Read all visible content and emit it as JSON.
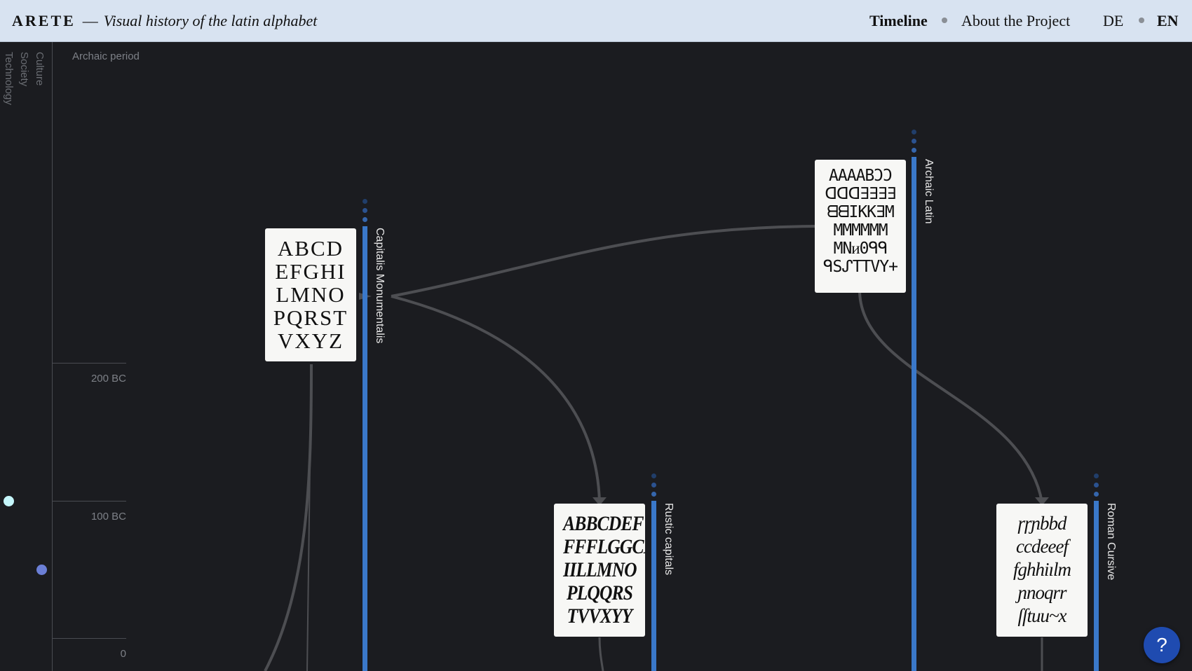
{
  "header": {
    "brand": "ARETE",
    "dash": "—",
    "tagline": "Visual history of the latin alphabet",
    "nav_timeline": "Timeline",
    "nav_about": "About the Project",
    "lang_de": "DE",
    "lang_en": "EN"
  },
  "sidebar": {
    "categories": [
      "Culture",
      "Society",
      "Technology"
    ]
  },
  "timeline": {
    "period": "Archaic period",
    "ticks": [
      "200 BC",
      "100 BC",
      "0"
    ]
  },
  "scripts": [
    {
      "name": "Capitalis Monumentalis",
      "letters": [
        "ABCD",
        "EFGHI",
        "LMNO",
        "PQRST",
        "VXYZ"
      ]
    },
    {
      "name": "Rustic capitals",
      "letters": [
        "ABBCDEF",
        "FFFLGGCH",
        "IILLMNO",
        "PLQQRS",
        "TVVXYY"
      ]
    },
    {
      "name": "Archaic Latin",
      "letters": [
        "AAAABƆƆ",
        "ᗡᗡᗡ∃∃∃∃",
        "ᗺᗺIKK∃M",
        "MMMMMM",
        "MNᴎ0ᑫᑫ",
        "ᑫSᔑTTVY+"
      ]
    },
    {
      "name": "Roman Cursive",
      "letters": [
        "ɼɼɲbbd",
        "ccdeeef",
        "fghhiılm",
        "ɲnoqrr",
        "ſſtuu~x"
      ]
    }
  ],
  "help_label": "?",
  "colors": {
    "header_bg": "#d8e3f1",
    "canvas_bg": "#1b1c20",
    "bar_blue": "#3a78c9",
    "link_gray": "#4d4e52",
    "help_blue": "#1f4bb0",
    "dot_cyan": "#c5f6fb",
    "dot_violet": "#6b7fd6"
  }
}
